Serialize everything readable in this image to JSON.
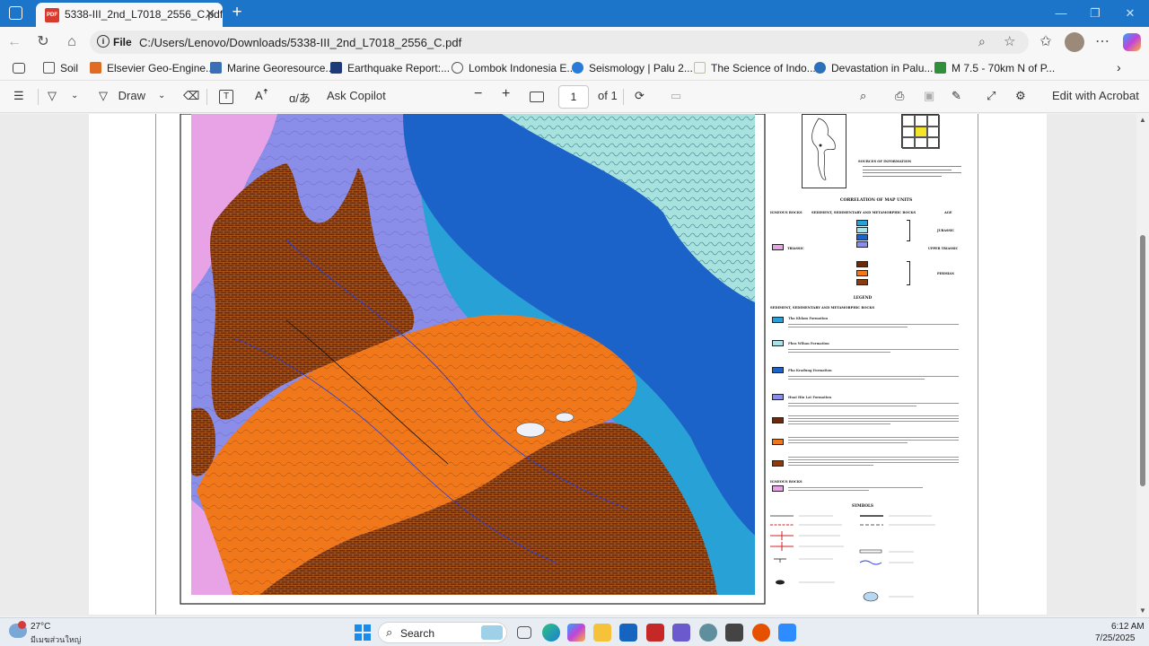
{
  "browser": {
    "tab_title": "5338-III_2nd_L7018_2556_C.pdf",
    "address_scheme": "File",
    "address_url": "C:/Users/Lenovo/Downloads/5338-III_2nd_L7018_2556_C.pdf"
  },
  "bookmarks": [
    {
      "label": "Soil",
      "color": "#5f6368"
    },
    {
      "label": "Elsevier Geo-Engine...",
      "color": "#e06b22"
    },
    {
      "label": "Marine Georesource...",
      "color": "#3b6fb6"
    },
    {
      "label": "Earthquake Report:...",
      "color": "#1e3a78"
    },
    {
      "label": "Lombok Indonesia E...",
      "color": "#5f6368"
    },
    {
      "label": "Seismology | Palu 2...",
      "color": "#2a7ad8"
    },
    {
      "label": "The Science of Indo...",
      "color": "#e7c21e"
    },
    {
      "label": "Devastation in Palu...",
      "color": "#2d6fb8"
    },
    {
      "label": "M 7.5 - 70km N of P...",
      "color": "#2f8f3a"
    }
  ],
  "pdf_toolbar": {
    "draw_label": "Draw",
    "ask_copilot_label": "Ask Copilot",
    "page_number": "1",
    "page_total": "of 1",
    "edit_label": "Edit with Acrobat"
  },
  "map_legend": {
    "sources_title": "SOURCES OF INFORMATION",
    "correlation_title": "CORRELATION OF MAP UNITS",
    "col_igneous": "IGNEOUS ROCKS",
    "col_sediment": "SEDIMENT, SEDIMENTARY AND METAMORPHIC ROCKS",
    "col_age": "AGE",
    "age_jurassic": "JURASSIC",
    "age_upper_triassic": "UPPER TRIASSIC",
    "age_permian": "PERMIAN",
    "label_triassic": "TRIASSIC",
    "legend_title": "LEGEND",
    "legend_sub": "SEDIMENT, SEDIMENTARY AND METAMORPHIC ROCKS",
    "units": [
      {
        "name": "Tha Khlam Formation",
        "color": "#28a2d6"
      },
      {
        "name": "Phra Wihan Formation",
        "color": "#a6e2e8"
      },
      {
        "name": "Pha Kradung Formation",
        "color": "#1b63c9"
      },
      {
        "name": "Huai Hin Lat Formation",
        "color": "#8a8ee8"
      },
      {
        "name": "",
        "color": "#6b2a08"
      },
      {
        "name": "",
        "color": "#f0781a"
      },
      {
        "name": "",
        "color": "#8a3c0e"
      }
    ],
    "igneous_title": "IGNEOUS ROCKS",
    "symbols_title": "SYMBOLS",
    "colors": {
      "igneous": "#e7a3e6"
    }
  },
  "taskbar": {
    "weather_temp": "27°C",
    "weather_desc": "มีเมฆส่วนใหญ่",
    "search_label": "Search",
    "time": "6:12 AM",
    "date": "7/25/2025"
  }
}
